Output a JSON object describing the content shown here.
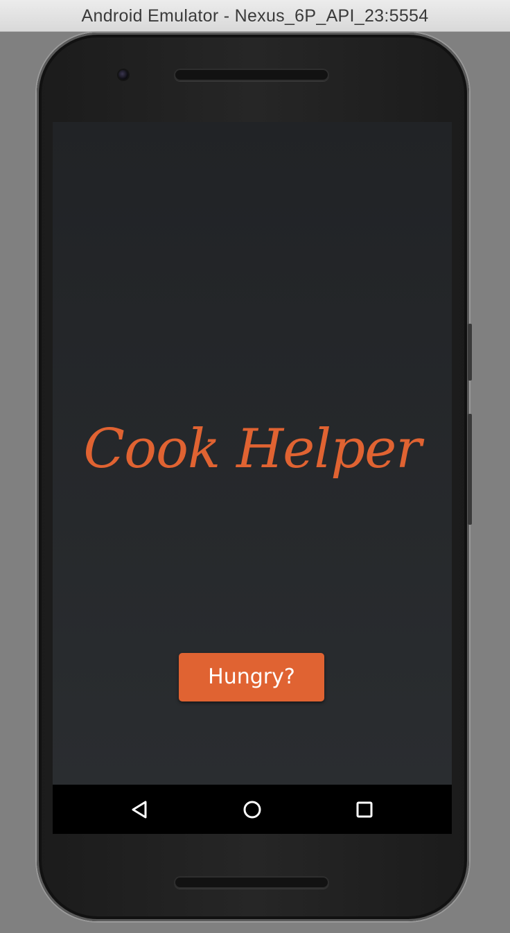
{
  "window": {
    "title": "Android Emulator - Nexus_6P_API_23:5554"
  },
  "app": {
    "title": "Cook Helper",
    "action_label": "Hungry?",
    "accent_color": "#e06332",
    "background_color": "#25282b"
  },
  "navbar": {
    "back_icon": "back-triangle-icon",
    "home_icon": "home-circle-icon",
    "recents_icon": "recents-square-icon"
  }
}
